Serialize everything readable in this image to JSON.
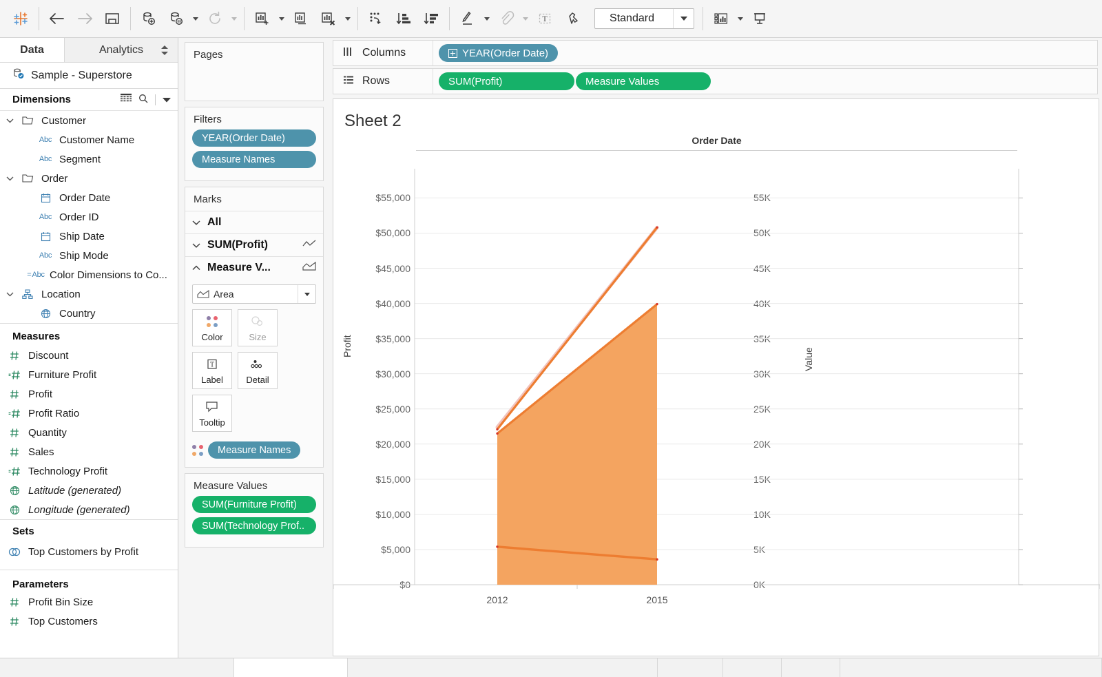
{
  "toolbar": {
    "items": [
      {
        "name": "tableau-logo-icon",
        "label": ""
      },
      {
        "name": "back-icon",
        "label": ""
      },
      {
        "name": "forward-icon",
        "label": ""
      },
      {
        "name": "save-icon",
        "label": ""
      },
      {
        "name": "new-data-source-icon",
        "label": ""
      },
      {
        "name": "pause-data-source-icon",
        "label": ""
      },
      {
        "name": "refresh-data-source-icon",
        "label": ""
      },
      {
        "name": "new-worksheet-icon",
        "label": ""
      },
      {
        "name": "duplicate-sheet-icon",
        "label": ""
      },
      {
        "name": "clear-sheet-icon",
        "label": ""
      },
      {
        "name": "swap-rows-columns-icon",
        "label": ""
      },
      {
        "name": "sort-ascending-icon",
        "label": ""
      },
      {
        "name": "sort-descending-icon",
        "label": ""
      },
      {
        "name": "highlight-icon",
        "label": ""
      },
      {
        "name": "group-members-icon",
        "label": ""
      },
      {
        "name": "show-mark-labels-icon",
        "label": ""
      },
      {
        "name": "fix-axes-icon",
        "label": ""
      },
      {
        "name": "show-me-icon",
        "label": ""
      },
      {
        "name": "presentation-mode-icon",
        "label": ""
      }
    ],
    "fit": {
      "value": "Standard"
    }
  },
  "left_pane": {
    "tabs": {
      "data": "Data",
      "analytics": "Analytics"
    },
    "data_source": "Sample - Superstore",
    "dimensions": {
      "header": "Dimensions",
      "items": [
        {
          "label": "Customer",
          "icon": "folder-icon",
          "level": 1,
          "expandable": true
        },
        {
          "label": "Customer Name",
          "icon": "abc-icon",
          "level": 2
        },
        {
          "label": "Segment",
          "icon": "abc-icon",
          "level": 2
        },
        {
          "label": "Order",
          "icon": "folder-icon",
          "level": 1,
          "expandable": true
        },
        {
          "label": "Order Date",
          "icon": "calendar-icon",
          "level": 2
        },
        {
          "label": "Order ID",
          "icon": "abc-icon",
          "level": 2
        },
        {
          "label": "Ship Date",
          "icon": "calendar-icon",
          "level": 2
        },
        {
          "label": "Ship Mode",
          "icon": "abc-icon",
          "level": 2
        },
        {
          "label": "Color Dimensions to Co...",
          "icon": "calculated-abc-icon",
          "level": 1.5
        },
        {
          "label": "Location",
          "icon": "hierarchy-icon",
          "level": 1,
          "expandable": true
        },
        {
          "label": "Country",
          "icon": "globe-icon",
          "level": 2
        }
      ]
    },
    "measures": {
      "header": "Measures",
      "items": [
        {
          "label": "Discount",
          "icon": "number-icon"
        },
        {
          "label": "Furniture Profit",
          "icon": "calculated-number-icon"
        },
        {
          "label": "Profit",
          "icon": "number-icon"
        },
        {
          "label": "Profit Ratio",
          "icon": "calculated-number-icon"
        },
        {
          "label": "Quantity",
          "icon": "number-icon"
        },
        {
          "label": "Sales",
          "icon": "number-icon"
        },
        {
          "label": "Technology Profit",
          "icon": "calculated-number-icon"
        },
        {
          "label": "Latitude (generated)",
          "icon": "geo-icon",
          "italic": true
        },
        {
          "label": "Longitude (generated)",
          "icon": "geo-icon",
          "italic": true
        }
      ]
    },
    "sets": {
      "header": "Sets",
      "items": [
        {
          "label": "Top Customers by Profit",
          "icon": "set-icon"
        }
      ]
    },
    "parameters": {
      "header": "Parameters",
      "items": [
        {
          "label": "Profit Bin Size",
          "icon": "number-icon"
        },
        {
          "label": "Top Customers",
          "icon": "number-icon"
        }
      ]
    }
  },
  "cards": {
    "pages": {
      "title": "Pages",
      "items": []
    },
    "filters": {
      "title": "Filters",
      "items": [
        "YEAR(Order Date)",
        "Measure Names"
      ]
    },
    "marks": {
      "title": "Marks",
      "rows": [
        {
          "label": "All",
          "bold": true,
          "expanded": true,
          "mark_icon": ""
        },
        {
          "label": "SUM(Profit)",
          "bold": true,
          "expanded": true,
          "mark_icon": "line-icon"
        },
        {
          "label": "Measure V...",
          "bold": true,
          "expanded": false,
          "mark_icon": "area-icon"
        }
      ],
      "mark_type": "Area",
      "buttons": [
        {
          "label": "Color",
          "icon": "color-icon",
          "enabled": true
        },
        {
          "label": "Size",
          "icon": "size-icon",
          "enabled": false
        },
        {
          "label": "Label",
          "icon": "label-icon",
          "enabled": true
        },
        {
          "label": "Detail",
          "icon": "detail-icon",
          "enabled": true
        },
        {
          "label": "Tooltip",
          "icon": "tooltip-icon",
          "enabled": true
        }
      ],
      "legend_pill": "Measure Names"
    },
    "measure_values": {
      "title": "Measure Values",
      "items": [
        "SUM(Furniture Profit)",
        "SUM(Technology Prof.."
      ]
    }
  },
  "shelves": {
    "columns": {
      "label": "Columns",
      "pills": [
        {
          "text": "YEAR(Order Date)",
          "color": "blue",
          "expand": true
        }
      ]
    },
    "rows": {
      "label": "Rows",
      "pills": [
        {
          "text": "SUM(Profit)",
          "color": "green"
        },
        {
          "text": "Measure Values",
          "color": "green"
        }
      ]
    }
  },
  "view": {
    "sheet_title": "Sheet 2"
  },
  "chart_data": {
    "type": "area",
    "title": "Sheet 2",
    "column_title": "Order Date",
    "xlabel": "",
    "ylabel": "Profit",
    "y2label": "Value",
    "x": [
      2012,
      2015
    ],
    "xticklabels": [
      "2012",
      "2015"
    ],
    "ylim": [
      0,
      57000
    ],
    "yticklabels": [
      "$0",
      "$5,000",
      "$10,000",
      "$15,000",
      "$20,000",
      "$25,000",
      "$30,000",
      "$35,000",
      "$40,000",
      "$45,000",
      "$50,000",
      "$55,000"
    ],
    "yticks": [
      0,
      5000,
      10000,
      15000,
      20000,
      25000,
      30000,
      35000,
      40000,
      45000,
      50000,
      55000
    ],
    "y2lim": [
      0,
      57000
    ],
    "y2ticklabels": [
      "0K",
      "5K",
      "10K",
      "15K",
      "20K",
      "25K",
      "30K",
      "35K",
      "40K",
      "45K",
      "50K",
      "55K"
    ],
    "y2ticks": [
      0,
      5000,
      10000,
      15000,
      20000,
      25000,
      30000,
      35000,
      40000,
      45000,
      50000,
      55000
    ],
    "grid": true,
    "legend_position": "none",
    "series": [
      {
        "name": "SUM(Profit)",
        "type": "line",
        "color": "#ed7d31",
        "values": [
          22100,
          50800
        ]
      },
      {
        "name": "SUM(Technology Profit)",
        "type": "area",
        "color": "#f4a460",
        "line_color": "#ed7d31",
        "values": [
          21500,
          39900
        ]
      },
      {
        "name": "SUM(Furniture Profit)",
        "type": "area",
        "color": "#f4a460",
        "line_color": "#ed7d31",
        "values": [
          5400,
          3600
        ]
      },
      {
        "name": "SUM(Profit) faint",
        "type": "line",
        "color": "#f2c3bd",
        "values": [
          22400,
          50800
        ]
      }
    ]
  }
}
